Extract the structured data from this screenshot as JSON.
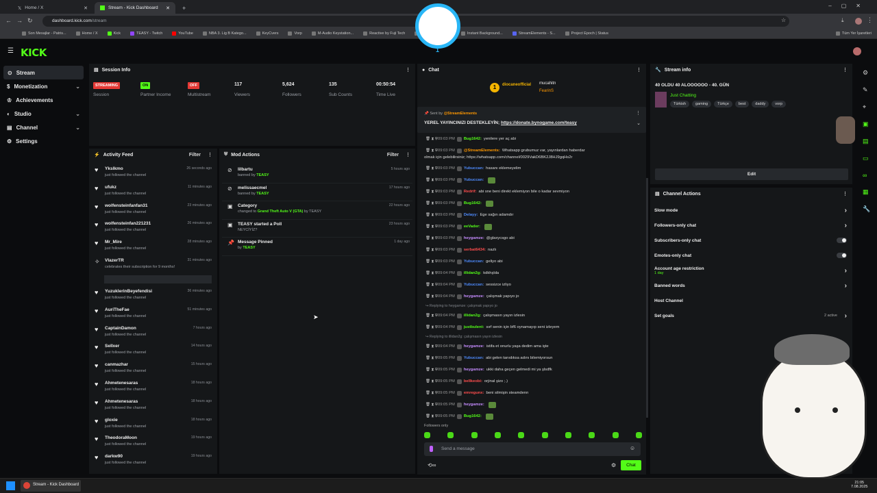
{
  "browser": {
    "tab1": "Home / X",
    "tab2": "Stream - Kick Dashboard",
    "url_host": "dashboard.kick.com",
    "url_path": "/stream",
    "bookmarks": [
      "Son Mesajlar - Patris...",
      "Home / X",
      "Kick",
      "TEASY - Twitch",
      "YouTube",
      "NBA 3. Lig B Katego...",
      "KeyCvers",
      "Vorp",
      "M-Audio Keystation...",
      "Reactive by Fuji Tech",
      "Fi",
      "Instant Background...",
      "StreamElements - S...",
      "Project Epoch | Status"
    ],
    "all_bookmarks": "Tüm Yer İşaretleri"
  },
  "logo": "KICK",
  "sidebar": [
    {
      "label": "Stream",
      "icon": "stream-icon"
    },
    {
      "label": "Monetization",
      "icon": "dollar-icon"
    },
    {
      "label": "Achievements",
      "icon": "trophy-icon"
    },
    {
      "label": "Studio",
      "icon": "studio-icon"
    },
    {
      "label": "Channel",
      "icon": "channel-icon"
    },
    {
      "label": "Settings",
      "icon": "gear-icon"
    }
  ],
  "session": {
    "title": "Session Info",
    "stats": [
      {
        "badge": "STREAMING",
        "color": "#e53935",
        "fg": "#fff",
        "label": "Session"
      },
      {
        "badge": "ON",
        "color": "#53fc18",
        "fg": "#000",
        "label": "Partner Income"
      },
      {
        "badge": "OFF",
        "color": "#e53935",
        "fg": "#fff",
        "label": "Multistream"
      },
      {
        "value": "117",
        "label": "Viewers"
      },
      {
        "value": "5,624",
        "label": "Followers"
      },
      {
        "value": "135",
        "label": "Sub Counts"
      },
      {
        "value": "00:50:54",
        "label": "Time Live"
      }
    ]
  },
  "activity": {
    "title": "Activity Feed",
    "filter": "Filter",
    "items": [
      {
        "name": "Ykslkmo",
        "sub": "just followed the channel",
        "time": "26 seconds ago"
      },
      {
        "name": "ufukz",
        "sub": "just followed the channel",
        "time": "11 minutes ago"
      },
      {
        "name": "wolfensteinfanfan31",
        "sub": "just followed the channel",
        "time": "23 minutes ago"
      },
      {
        "name": "wolfensteinfan221231",
        "sub": "just followed the channel",
        "time": "26 minutes ago"
      },
      {
        "name": "Mr_Mire",
        "sub": "just followed the channel",
        "time": "28 minutes ago"
      },
      {
        "name": "VlazerTR",
        "sub": "celebrates their subscription for 9 months!",
        "time": "31 minutes ago"
      },
      {
        "name": "YuzuklerinBeyefendisi",
        "sub": "just followed the channel",
        "time": "36 minutes ago"
      },
      {
        "name": "AuriTheFae",
        "sub": "just followed the channel",
        "time": "51 minutes ago"
      },
      {
        "name": "CaptainDamon",
        "sub": "just followed the channel",
        "time": "7 hours ago"
      },
      {
        "name": "Sellxer",
        "sub": "just followed the channel",
        "time": "14 hours ago"
      },
      {
        "name": "canmazhar",
        "sub": "just followed the channel",
        "time": "15 hours ago"
      },
      {
        "name": "Ahmetenesaras",
        "sub": "just followed the channel",
        "time": "18 hours ago"
      },
      {
        "name": "Ahmetenesaras",
        "sub": "just followed the channel",
        "time": "18 hours ago"
      },
      {
        "name": "gloxie",
        "sub": "just followed the channel",
        "time": "18 hours ago"
      },
      {
        "name": "TheodoraMoon",
        "sub": "just followed the channel",
        "time": "19 hours ago"
      },
      {
        "name": "darkw90",
        "sub": "just followed the channel",
        "time": "19 hours ago"
      }
    ]
  },
  "mod": {
    "title": "Mod Actions",
    "filter": "Filter",
    "items": [
      {
        "name": "lilbartu",
        "pre": "banned by ",
        "hl": "TEASY",
        "post": "",
        "time": "5 hours ago"
      },
      {
        "name": "melissaecmel",
        "pre": "banned by ",
        "hl": "TEASY",
        "post": "",
        "time": "17 hours ago"
      },
      {
        "name": "Category",
        "pre": "changed to ",
        "hl": "Grand Theft Auto V (GTA)",
        "post": " by TEASY",
        "time": "22 hours ago"
      },
      {
        "name": "TEASY started a Poll",
        "pre": "NEYCİYİZ?",
        "hl": "",
        "post": "",
        "time": "23 hours ago"
      },
      {
        "name": "Message Pinned",
        "pre": "by ",
        "hl": "TEASY",
        "post": "",
        "time": "1 day ago"
      }
    ]
  },
  "chat": {
    "title": "Chat",
    "top1": "diocaneofficial",
    "top2": "mucahitn",
    "top3": "FearinS",
    "pinned_by": "Sent by",
    "pinned_user": "@StreamElements",
    "pinned_text": "YEREL YAYINCINIZI DESTEKLEYİN; ",
    "pinned_link": "https://donate.bynogame.com/teasy",
    "placeholder": "Send a message",
    "followers_only": "Followers only",
    "send": "Chat",
    "messages": [
      {
        "t": "09:03 PM",
        "u": "Bug1642:",
        "c": "#53fc18",
        "m": "yenilere yer aç abi"
      },
      {
        "t": "09:03 PM",
        "u": "@StreamElements:",
        "c": "#ff9800",
        "m": "Whatsapp grubumuz var, yayınlardan haberdar"
      },
      {
        "t": "",
        "u": "",
        "c": "#ddd",
        "m": "olmak için gelebilirsiniz; https://whatsapp.com/channel/0029VakD6BK2J8HJ9gqHs2r"
      },
      {
        "t": "09:03 PM",
        "u": "Yubuccan:",
        "c": "#4f8cff",
        "m": "hasanı eklemeyelim"
      },
      {
        "t": "09:03 PM",
        "u": "Yubuccan:",
        "c": "#4f8cff",
        "m": ""
      },
      {
        "t": "09:03 PM",
        "u": "Redrif:",
        "c": "#ff4d4d",
        "m": "abi sne beni direkt eklemiyon bile o kadar sevmiyon"
      },
      {
        "t": "09:03 PM",
        "u": "Bug1642:",
        "c": "#53fc18",
        "m": ""
      },
      {
        "t": "09:03 PM",
        "u": "Delayy:",
        "c": "#4f8cff",
        "m": "Ege sağın adamdır"
      },
      {
        "t": "09:03 PM",
        "u": "eeVader:",
        "c": "#53fc18",
        "m": ""
      },
      {
        "t": "09:03 PM",
        "u": "heygamze:",
        "c": "#c68cff",
        "m": "@glaxycsgo abi"
      },
      {
        "t": "09:03 PM",
        "u": "serbat6434:",
        "c": "#ff4d4d",
        "m": "nazlı"
      },
      {
        "t": "09:03 PM",
        "u": "Yubuccan:",
        "c": "#4f8cff",
        "m": "geliyo abi"
      },
      {
        "t": "09:04 PM",
        "u": "illidan2g:",
        "c": "#53fc18",
        "m": "kdkhşlda"
      },
      {
        "t": "09:04 PM",
        "u": "Yubuccan:",
        "c": "#4f8cff",
        "m": "sessizce izliyo"
      },
      {
        "t": "09:04 PM",
        "u": "heygamze:",
        "c": "#c68cff",
        "m": "çalışmak yapıyo jo"
      },
      {
        "t": "09:04 PM",
        "u": "illidan2g:",
        "c": "#53fc18",
        "m": "çalışmasın yayın izlesin",
        "reply": "Replying to heygamze: çalışmak yapıyo jo"
      },
      {
        "t": "09:04 PM",
        "u": "justbulent:",
        "c": "#53fc18",
        "m": "sırf senin için bf6 oynamayıp seni izleyem"
      },
      {
        "t": "09:04 PM",
        "u": "heygamze:",
        "c": "#c68cff",
        "m": "istifa et onurlu yaşa dedim ama işte",
        "reply": "Replying to illidan2g: çalışmasın yayın izlesin"
      },
      {
        "t": "09:05 PM",
        "u": "Yubuccan:",
        "c": "#4f8cff",
        "m": "abi gelen tanıdıksa adını bilemiyorsun"
      },
      {
        "t": "09:05 PM",
        "u": "heygamze:",
        "c": "#c68cff",
        "m": "ukki daha geçen gelmedi mi ya şlsdfk"
      },
      {
        "t": "09:05 PM",
        "u": "bellkeobi:",
        "c": "#ff4d4d",
        "m": "orjinal şizo ;.)"
      },
      {
        "t": "09:05 PM",
        "u": "emregunx:",
        "c": "#ff4d4d",
        "m": "beni silmişin steamdenn"
      },
      {
        "t": "09:05 PM",
        "u": "heygamze:",
        "c": "#c68cff",
        "m": ""
      },
      {
        "t": "09:05 PM",
        "u": "Bug1642:",
        "c": "#53fc18",
        "m": ""
      }
    ]
  },
  "streaminfo": {
    "title": "Stream info",
    "stream_title": "40 OLDU 40 ALOOOOOO - 40. GÜN",
    "category": "Just Chatting",
    "tags": [
      "Türkish",
      "gaming",
      "Türkçe",
      "best",
      "daddy",
      "vorp"
    ],
    "edit": "Edit"
  },
  "actions": {
    "title": "Channel Actions",
    "items": [
      {
        "label": "Slow mode",
        "ctl": "arrow"
      },
      {
        "label": "Followers-only chat",
        "ctl": "arrow"
      },
      {
        "label": "Subscribers-only chat",
        "ctl": "toggle"
      },
      {
        "label": "Emotes-only chat",
        "ctl": "toggle"
      },
      {
        "label": "Account age restriction",
        "sub": "1 day",
        "ctl": "arrow"
      },
      {
        "label": "Banned words",
        "ctl": "arrow"
      },
      {
        "label": "Host Channel",
        "ctl": "none"
      },
      {
        "label": "Set goals",
        "extra": "2 active",
        "ctl": "arrow"
      }
    ]
  },
  "taskbar": {
    "app": "Stream - Kick Dashboard",
    "time": "21:05",
    "date": "7.08.2025"
  },
  "overlay": {
    "digit": "1"
  }
}
